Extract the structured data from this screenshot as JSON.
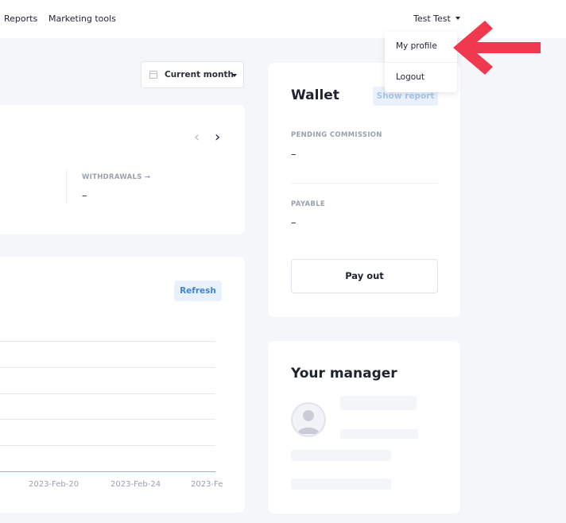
{
  "nav": {
    "items": [
      "Reports",
      "Marketing tools"
    ]
  },
  "user": {
    "name": "Test Test"
  },
  "user_menu": {
    "items": [
      "My profile",
      "Logout"
    ]
  },
  "period": {
    "selected": "Current month"
  },
  "stats": {
    "prev_icon": "chevron-left-icon",
    "next_icon": "chevron-right-icon",
    "withdrawals": {
      "label": "WITHDRAWALS →",
      "value": "–"
    }
  },
  "chart": {
    "refresh_label": "Refresh",
    "x_ticks": [
      "2023-Feb-20",
      "2023-Feb-24",
      "2023-Fe"
    ],
    "baseline_color": "#7fc6a8"
  },
  "wallet": {
    "title": "Wallet",
    "show_report_label": "Show report",
    "pending_label": "PENDING COMMISSION",
    "pending_value": "–",
    "payable_label": "PAYABLE",
    "payable_value": "–",
    "payout_label": "Pay out"
  },
  "manager": {
    "title": "Your manager"
  },
  "colors": {
    "accent": "#3f86d8",
    "arrow": "#f0384f"
  }
}
